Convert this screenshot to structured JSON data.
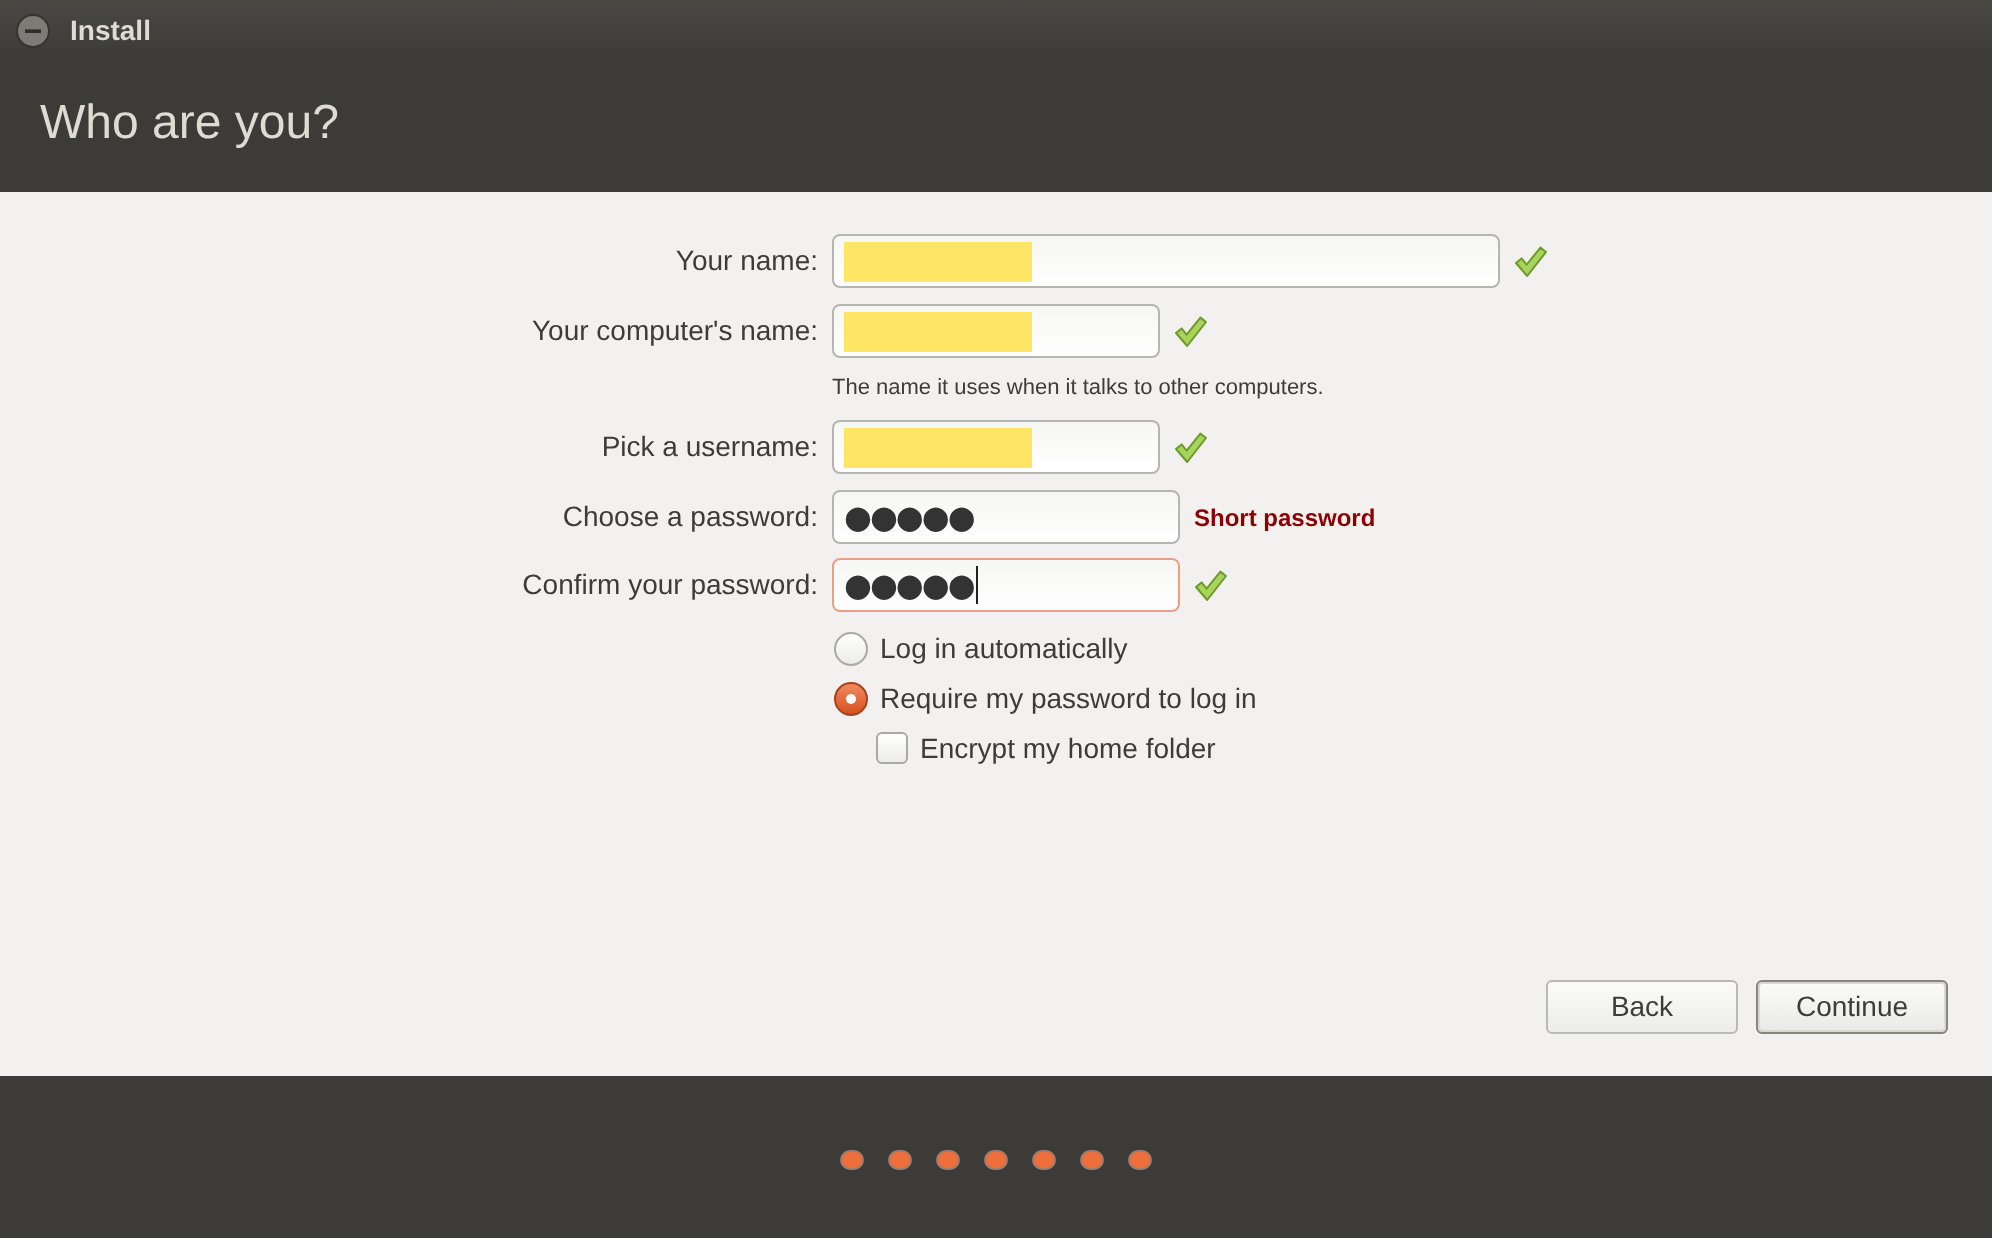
{
  "window": {
    "title": "Install"
  },
  "header": {
    "title": "Who are you?"
  },
  "form": {
    "fields": [
      {
        "label": "Your name:",
        "kind": "text",
        "redacted": true,
        "valid": true,
        "focused": false
      },
      {
        "label": "Your computer's name:",
        "kind": "text",
        "redacted": true,
        "valid": true,
        "focused": false,
        "hint": "The name it uses when it talks to other computers."
      },
      {
        "label": "Pick a username:",
        "kind": "text",
        "redacted": true,
        "valid": true,
        "focused": false
      },
      {
        "label": "Choose a password:",
        "kind": "password",
        "value": "●●●●●",
        "valid": false,
        "focused": false,
        "message": "Short password"
      },
      {
        "label": "Confirm your password:",
        "kind": "password",
        "value": "●●●●●",
        "valid": true,
        "focused": true
      }
    ],
    "login_options": [
      {
        "label": "Log in automatically",
        "selected": false
      },
      {
        "label": "Require my password to log in",
        "selected": true
      }
    ],
    "encrypt_home": {
      "label": "Encrypt my home folder",
      "checked": false
    }
  },
  "buttons": [
    {
      "label": "Back",
      "default": false
    },
    {
      "label": "Continue",
      "default": true
    }
  ],
  "progress_dots": [
    {
      "filled": true
    },
    {
      "filled": true
    },
    {
      "filled": true
    },
    {
      "filled": true
    },
    {
      "filled": true
    },
    {
      "filled": true
    },
    {
      "filled": true
    }
  ]
}
